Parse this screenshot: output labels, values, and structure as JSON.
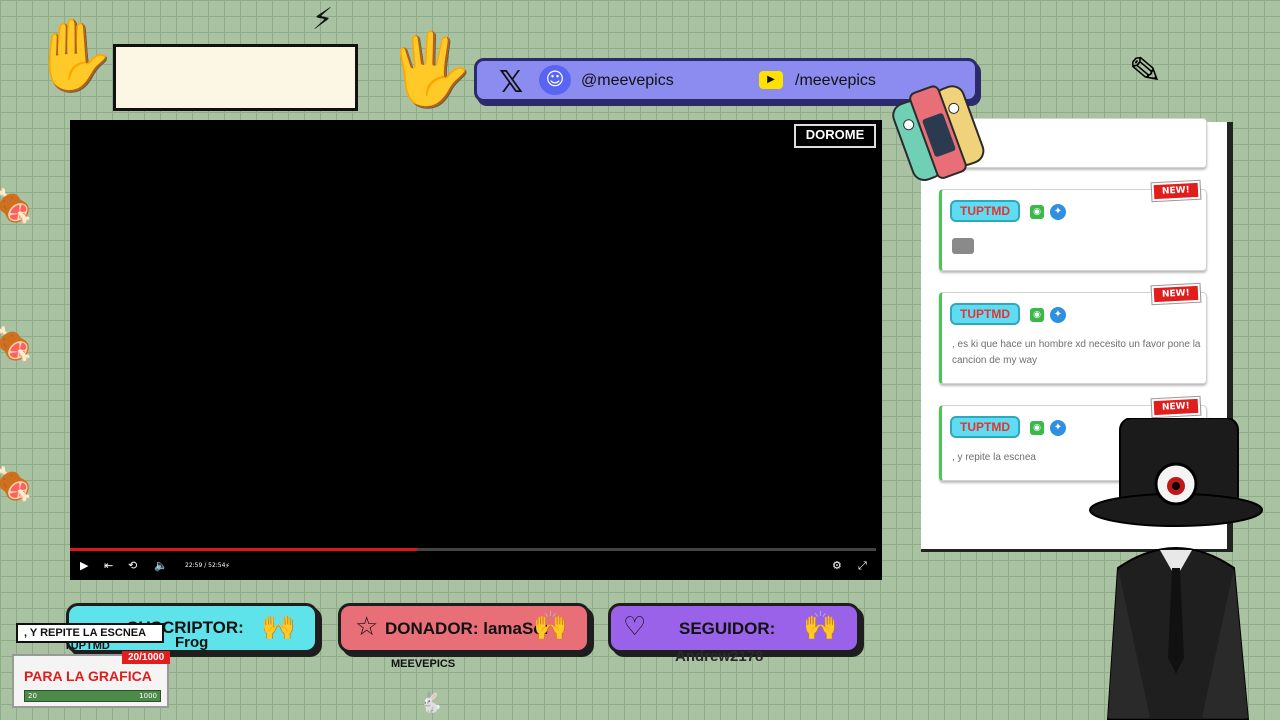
{
  "social": {
    "x_icon": "x-logo-icon",
    "discord_icon": "discord-icon",
    "handle": "@meevepics",
    "youtube_icon": "youtube-icon",
    "channel": "/meevepics"
  },
  "player": {
    "watermark": "DOROME",
    "time": "22:59 / 52:54",
    "progress_fraction": 0.43
  },
  "chat": {
    "messages": [
      {
        "user": "TUPTMD",
        "badge": "NEW!",
        "text": ""
      },
      {
        "user": "TUPTMD",
        "badge": "NEW!",
        "text": ", es ki que hace un hombre xd necesito un favor pone la cancion de my way"
      },
      {
        "user": "TUPTMD",
        "badge": "NEW!",
        "text": ", y repite la escnea"
      }
    ]
  },
  "alerts": {
    "subscriber": {
      "label": "SUSCRIPTOR:",
      "name": "Frog"
    },
    "donor": {
      "label": "DONADOR: lamaSor"
    },
    "follower": {
      "label": "SEGUIDOR:",
      "name": "Andrew2178"
    }
  },
  "goal": {
    "message": ", Y REPITE LA ESCNEA",
    "user": "TUPTMD",
    "badge": "20/1000",
    "title": "PARA LA GRAFICA",
    "min": "20",
    "max": "1000"
  },
  "footer": {
    "channel": "MEEVEPICS"
  },
  "colors": {
    "background": "#a9c3a2",
    "social_bar": "#8c8cf0",
    "subscriber_bar": "#5fe3ea",
    "donor_bar": "#e86f78",
    "follower_bar": "#9a62e8",
    "progress": "#e01616"
  }
}
